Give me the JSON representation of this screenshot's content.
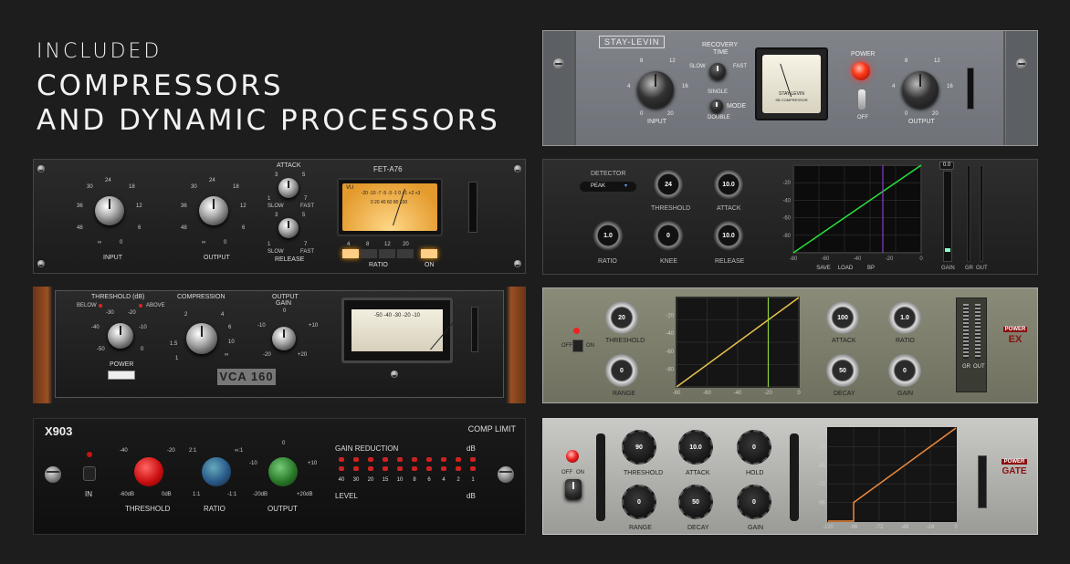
{
  "hero": {
    "line1": "INCLUDED",
    "line2": "COMPRESSORS",
    "line3": "AND DYNAMIC PROCESSORS"
  },
  "stay": {
    "brand": "STAY-LEVIN",
    "recovery": "RECOVERY",
    "time": "TIME",
    "slow": "SLOW",
    "fast": "FAST",
    "single": "SINGLE",
    "double": "DOUBLE",
    "mode": "MODE",
    "input": "INPUT",
    "output": "OUTPUT",
    "power": "POWER",
    "off": "OFF",
    "meter_text": "STAY-LEVIN",
    "meter_sub": "SB COMPRESSOR",
    "in_ticks": [
      "8",
      "12",
      "4",
      "16",
      "0",
      "20"
    ],
    "out_ticks": [
      "8",
      "12",
      "4",
      "16",
      "0",
      "20"
    ]
  },
  "fet": {
    "name": "FET-A76",
    "input": "INPUT",
    "output": "OUTPUT",
    "attack": "ATTACK",
    "release": "RELEASE",
    "slow": "SLOW",
    "fast": "FAST",
    "ratio": "RATIO",
    "on": "ON",
    "ratio_values": [
      "4",
      "8",
      "12",
      "20"
    ],
    "vu": "VU",
    "knob_ticks": [
      "24",
      "30",
      "18",
      "36",
      "12",
      "48",
      "6",
      "∞",
      "0"
    ],
    "att_ticks": [
      "3",
      "5",
      "1",
      "7"
    ],
    "meter_scale": "-20 -10 -7 -5 -3 -1 0 +1 +2 +3",
    "meter_low": "0 20 40 60 80 100"
  },
  "vca": {
    "threshold": "THRESHOLD (dB)",
    "below": "BELOW",
    "above": "ABOVE",
    "compression": "COMPRESSION",
    "output_gain": "OUTPUT",
    "gain": "GAIN",
    "power": "POWER",
    "logo": "VCA 160",
    "thr_ticks": [
      "-30",
      "-20",
      "-40",
      "-10",
      "-50",
      "0"
    ],
    "comp_ticks": [
      "2",
      "4",
      "1.5",
      "6",
      "1",
      "10",
      "∞"
    ],
    "out_ticks": [
      "0",
      "-10",
      "+10",
      "-20",
      "+20"
    ],
    "meter_scale": "-50 -40 -30 -20 -10"
  },
  "x903": {
    "name": "X903",
    "mode": "COMP LIMIT",
    "in": "IN",
    "threshold": "THRESHOLD",
    "ratio": "RATIO",
    "output": "OUTPUT",
    "gain_reduction": "GAIN  REDUCTION",
    "db": "dB",
    "level": "LEVEL",
    "db2": "dB",
    "thr_ticks": {
      "a": "-40",
      "b": "-20",
      "c": "-60dB",
      "d": "0dB"
    },
    "ratio_ticks": {
      "a": "2:1",
      "b": "∞:1",
      "c": "1:1",
      "d": "-1:1"
    },
    "out_ticks": {
      "a": "0",
      "b": "-10",
      "c": "+10",
      "d": "-20dB",
      "e": "+20dB"
    },
    "scale": [
      "40",
      "30",
      "20",
      "15",
      "10",
      "8",
      "6",
      "4",
      "2",
      "1"
    ]
  },
  "dyn": {
    "detector": "DETECTOR",
    "peak": "PEAK",
    "threshold": "THRESHOLD",
    "threshold_val": "24",
    "attack": "ATTACK",
    "attack_val": "10.0",
    "ratio": "RATIO",
    "ratio_val": "1.0",
    "knee": "KNEE",
    "knee_val": "0",
    "release": "RELEASE",
    "release_val": "10.0",
    "y_ticks": [
      "-20",
      "-40",
      "-60",
      "-80"
    ],
    "x_ticks": [
      "-80",
      "-60",
      "-40",
      "-20",
      "0"
    ],
    "save": "SAVE",
    "load": "LOAD",
    "bp": "BP",
    "meter_val": "0.0",
    "gain": "GAIN",
    "gr": "GR",
    "out": "OUT"
  },
  "ex": {
    "threshold": "THRESHOLD",
    "threshold_val": "20",
    "range": "RANGE",
    "range_val": "0",
    "attack": "ATTACK",
    "attack_val": "100",
    "ratio": "RATIO",
    "ratio_val": "1.0",
    "decay": "DECAY",
    "decay_val": "50",
    "gain": "GAIN",
    "gain_val": "0",
    "off": "OFF",
    "on": "ON",
    "y_ticks": [
      "-20",
      "-40",
      "-60",
      "-80"
    ],
    "x_ticks": [
      "-80",
      "-60",
      "-40",
      "-20",
      "0"
    ],
    "gr": "GR",
    "out": "OUT",
    "power": "POWER",
    "ex": "EX"
  },
  "gate": {
    "threshold": "THRESHOLD",
    "threshold_val": "90",
    "attack": "ATTACK",
    "attack_val": "10.0",
    "hold": "HOLD",
    "hold_val": "0",
    "range": "RANGE",
    "range_val": "0",
    "decay": "DECAY",
    "decay_val": "50",
    "gain": "GAIN",
    "gain_val": "0",
    "off": "OFF",
    "on": "ON",
    "y_ticks": [
      "-24",
      "-48",
      "-72",
      "-96"
    ],
    "x_ticks": [
      "-120",
      "-96",
      "-72",
      "-48",
      "-24",
      "0"
    ],
    "power": "POWER",
    "gate": "GATE"
  },
  "colors": {
    "accent_red": "#e0211a",
    "graph_green": "#27e23a",
    "graph_purple": "#8a3bd0",
    "graph_yellow": "#e8c34a",
    "graph_orange": "#f08a3a"
  }
}
